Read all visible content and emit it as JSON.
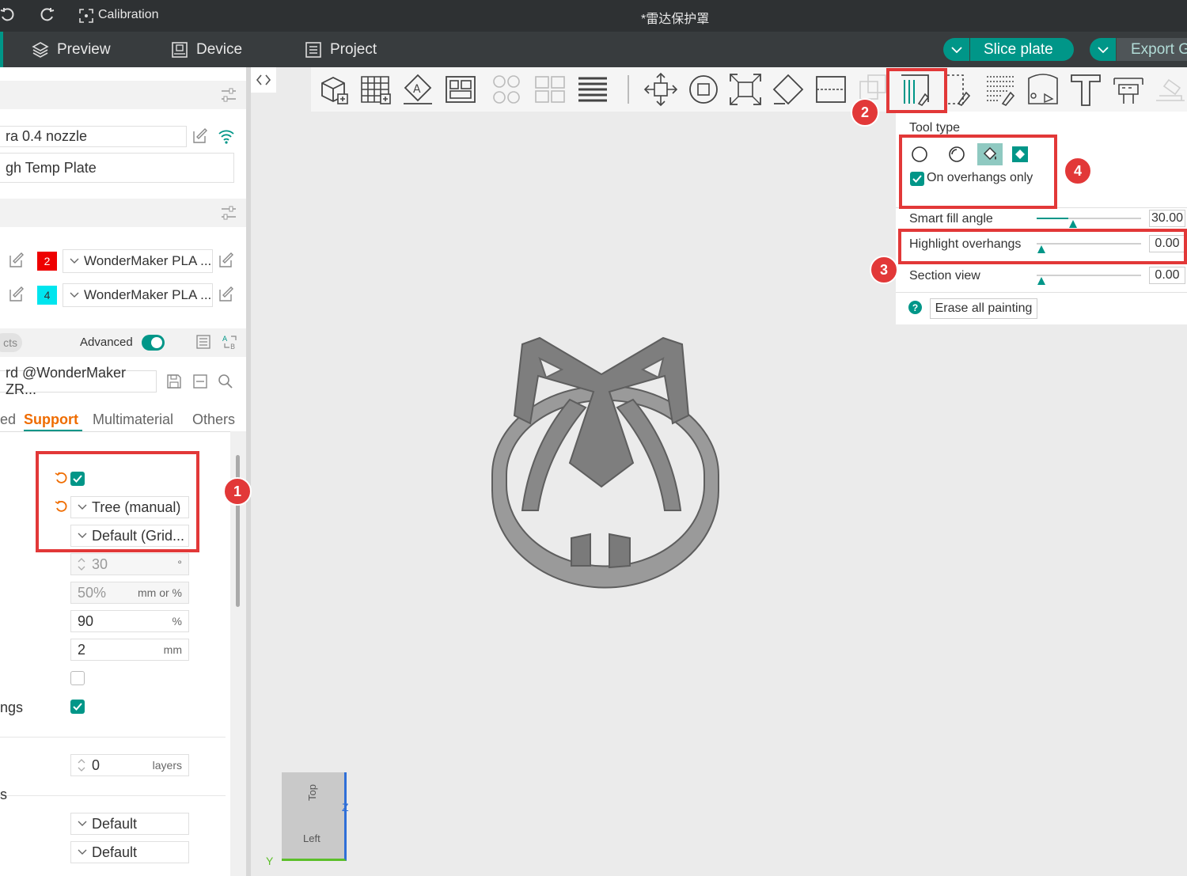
{
  "titlebar": {
    "calibration": "Calibration",
    "file_title": "*雷达保护罩"
  },
  "nav": {
    "preview": "Preview",
    "device": "Device",
    "project": "Project",
    "slice": "Slice plate",
    "export": "Export G"
  },
  "printer": {
    "nozzle": "ra 0.4 nozzle",
    "plate": "gh Temp Plate"
  },
  "filaments": [
    {
      "num": "2",
      "color": "#ee0000",
      "name": "WonderMaker PLA ..."
    },
    {
      "num": "4",
      "color": "#00e5ee",
      "name": "WonderMaker PLA ..."
    }
  ],
  "process": {
    "objects_tab": "cts",
    "advanced": "Advanced",
    "preset": "rd @WonderMaker ZR..."
  },
  "tabs": [
    "ed",
    "Support",
    "Multimaterial",
    "Others"
  ],
  "support": {
    "type": "Tree (manual)",
    "style": "Default (Grid...",
    "threshold": "30",
    "threshold_unit": "°",
    "initial": "50%",
    "initial_unit": "mm or %",
    "pct": "90",
    "pct_unit": "%",
    "dist": "2",
    "dist_unit": "mm",
    "overhangs_label": "ngs",
    "layers": "0",
    "layers_unit": "layers",
    "s_label": "s",
    "dd1": "Default",
    "dd2": "Default"
  },
  "paint": {
    "tool_type": "Tool type",
    "on_overhangs": "On overhangs only",
    "smart_fill": "Smart fill angle",
    "smart_fill_val": "30.00",
    "highlight": "Highlight overhangs",
    "highlight_val": "0.00",
    "section": "Section view",
    "section_val": "0.00",
    "erase": "Erase all painting"
  },
  "navcube": {
    "top": "Top",
    "left": "Left",
    "z": "Z",
    "y": "Y"
  },
  "badges": [
    "1",
    "2",
    "3",
    "4"
  ],
  "colors": {
    "accent": "#009688",
    "highlight": "#e23838",
    "support_tab": "#ef6c00"
  }
}
